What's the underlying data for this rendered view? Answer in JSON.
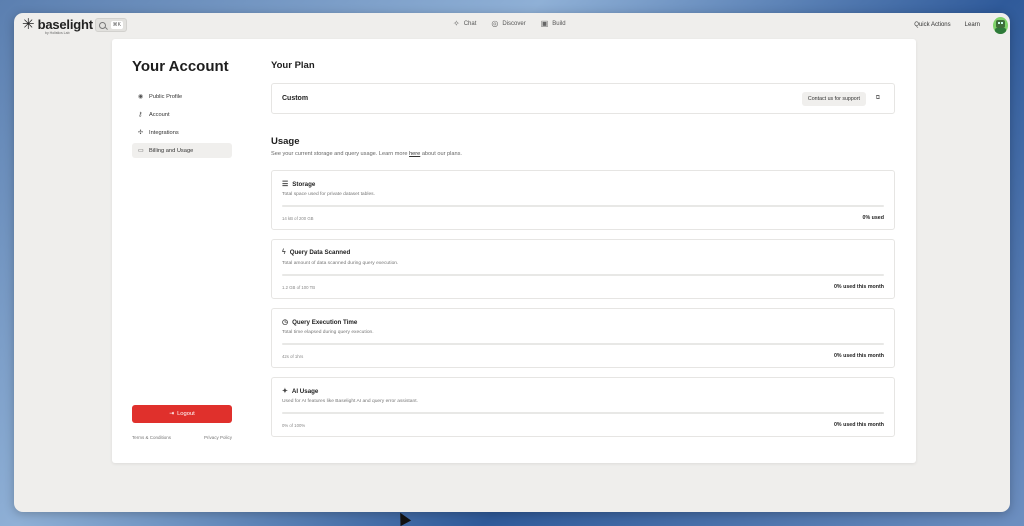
{
  "app": {
    "brand": "baselight",
    "brand_sub": "by Holistics Lab",
    "search_kbd": "⌘K"
  },
  "nav": [
    {
      "label": "Chat",
      "icon": "sparkle-icon"
    },
    {
      "label": "Discover",
      "icon": "compass-icon"
    },
    {
      "label": "Build",
      "icon": "terminal-icon"
    }
  ],
  "header_right": {
    "quick_actions": "Quick Actions",
    "learn": "Learn"
  },
  "sidebar": {
    "title": "Your Account",
    "items": [
      {
        "label": "Public Profile",
        "icon": "user-circle-icon",
        "active": false
      },
      {
        "label": "Account",
        "icon": "key-icon",
        "active": false
      },
      {
        "label": "Integrations",
        "icon": "integrations-icon",
        "active": false
      },
      {
        "label": "Billing and Usage",
        "icon": "card-icon",
        "active": true
      }
    ],
    "logout": "Logout",
    "terms": "Terms & Conditions",
    "privacy": "Privacy Policy"
  },
  "plan": {
    "heading": "Your Plan",
    "name": "Custom",
    "support_label": "Contact us for support"
  },
  "usage": {
    "heading": "Usage",
    "subtitle_pre": "See your current storage and query usage. Learn more ",
    "subtitle_link": "here",
    "subtitle_post": " about our plans.",
    "items": [
      {
        "title": "Storage",
        "icon": "database-icon",
        "desc": "Total space used for private dataset tables.",
        "amount": "14 kB of 200 GB",
        "percent_label": "0% used",
        "fraction": 0
      },
      {
        "title": "Query Data Scanned",
        "icon": "bolt-icon",
        "desc": "Total amount of data scanned during query execution.",
        "amount": "1.2 GB of 100 TB",
        "percent_label": "0% used this month",
        "fraction": 0
      },
      {
        "title": "Query Execution Time",
        "icon": "clock-icon",
        "desc": "Total time elapsed during query execution.",
        "amount": "42s of 1hrs",
        "percent_label": "0% used this month",
        "fraction": 0
      },
      {
        "title": "AI Usage",
        "icon": "ai-sparkle-icon",
        "desc": "Used for AI features like Baselight AI and query error assistant.",
        "amount": "0% of 100%",
        "percent_label": "0% used this month",
        "fraction": 0
      }
    ]
  }
}
